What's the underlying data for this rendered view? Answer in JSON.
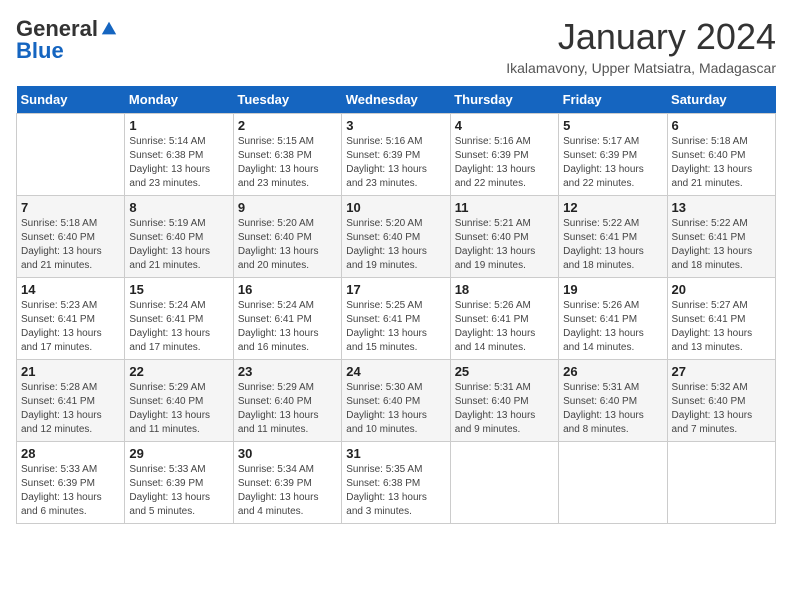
{
  "header": {
    "logo_general": "General",
    "logo_blue": "Blue",
    "month": "January 2024",
    "location": "Ikalamavony, Upper Matsiatra, Madagascar"
  },
  "weekdays": [
    "Sunday",
    "Monday",
    "Tuesday",
    "Wednesday",
    "Thursday",
    "Friday",
    "Saturday"
  ],
  "weeks": [
    [
      {
        "day": "",
        "info": ""
      },
      {
        "day": "1",
        "info": "Sunrise: 5:14 AM\nSunset: 6:38 PM\nDaylight: 13 hours\nand 23 minutes."
      },
      {
        "day": "2",
        "info": "Sunrise: 5:15 AM\nSunset: 6:38 PM\nDaylight: 13 hours\nand 23 minutes."
      },
      {
        "day": "3",
        "info": "Sunrise: 5:16 AM\nSunset: 6:39 PM\nDaylight: 13 hours\nand 23 minutes."
      },
      {
        "day": "4",
        "info": "Sunrise: 5:16 AM\nSunset: 6:39 PM\nDaylight: 13 hours\nand 22 minutes."
      },
      {
        "day": "5",
        "info": "Sunrise: 5:17 AM\nSunset: 6:39 PM\nDaylight: 13 hours\nand 22 minutes."
      },
      {
        "day": "6",
        "info": "Sunrise: 5:18 AM\nSunset: 6:40 PM\nDaylight: 13 hours\nand 21 minutes."
      }
    ],
    [
      {
        "day": "7",
        "info": "Sunrise: 5:18 AM\nSunset: 6:40 PM\nDaylight: 13 hours\nand 21 minutes."
      },
      {
        "day": "8",
        "info": "Sunrise: 5:19 AM\nSunset: 6:40 PM\nDaylight: 13 hours\nand 21 minutes."
      },
      {
        "day": "9",
        "info": "Sunrise: 5:20 AM\nSunset: 6:40 PM\nDaylight: 13 hours\nand 20 minutes."
      },
      {
        "day": "10",
        "info": "Sunrise: 5:20 AM\nSunset: 6:40 PM\nDaylight: 13 hours\nand 19 minutes."
      },
      {
        "day": "11",
        "info": "Sunrise: 5:21 AM\nSunset: 6:40 PM\nDaylight: 13 hours\nand 19 minutes."
      },
      {
        "day": "12",
        "info": "Sunrise: 5:22 AM\nSunset: 6:41 PM\nDaylight: 13 hours\nand 18 minutes."
      },
      {
        "day": "13",
        "info": "Sunrise: 5:22 AM\nSunset: 6:41 PM\nDaylight: 13 hours\nand 18 minutes."
      }
    ],
    [
      {
        "day": "14",
        "info": "Sunrise: 5:23 AM\nSunset: 6:41 PM\nDaylight: 13 hours\nand 17 minutes."
      },
      {
        "day": "15",
        "info": "Sunrise: 5:24 AM\nSunset: 6:41 PM\nDaylight: 13 hours\nand 17 minutes."
      },
      {
        "day": "16",
        "info": "Sunrise: 5:24 AM\nSunset: 6:41 PM\nDaylight: 13 hours\nand 16 minutes."
      },
      {
        "day": "17",
        "info": "Sunrise: 5:25 AM\nSunset: 6:41 PM\nDaylight: 13 hours\nand 15 minutes."
      },
      {
        "day": "18",
        "info": "Sunrise: 5:26 AM\nSunset: 6:41 PM\nDaylight: 13 hours\nand 14 minutes."
      },
      {
        "day": "19",
        "info": "Sunrise: 5:26 AM\nSunset: 6:41 PM\nDaylight: 13 hours\nand 14 minutes."
      },
      {
        "day": "20",
        "info": "Sunrise: 5:27 AM\nSunset: 6:41 PM\nDaylight: 13 hours\nand 13 minutes."
      }
    ],
    [
      {
        "day": "21",
        "info": "Sunrise: 5:28 AM\nSunset: 6:41 PM\nDaylight: 13 hours\nand 12 minutes."
      },
      {
        "day": "22",
        "info": "Sunrise: 5:29 AM\nSunset: 6:40 PM\nDaylight: 13 hours\nand 11 minutes."
      },
      {
        "day": "23",
        "info": "Sunrise: 5:29 AM\nSunset: 6:40 PM\nDaylight: 13 hours\nand 11 minutes."
      },
      {
        "day": "24",
        "info": "Sunrise: 5:30 AM\nSunset: 6:40 PM\nDaylight: 13 hours\nand 10 minutes."
      },
      {
        "day": "25",
        "info": "Sunrise: 5:31 AM\nSunset: 6:40 PM\nDaylight: 13 hours\nand 9 minutes."
      },
      {
        "day": "26",
        "info": "Sunrise: 5:31 AM\nSunset: 6:40 PM\nDaylight: 13 hours\nand 8 minutes."
      },
      {
        "day": "27",
        "info": "Sunrise: 5:32 AM\nSunset: 6:40 PM\nDaylight: 13 hours\nand 7 minutes."
      }
    ],
    [
      {
        "day": "28",
        "info": "Sunrise: 5:33 AM\nSunset: 6:39 PM\nDaylight: 13 hours\nand 6 minutes."
      },
      {
        "day": "29",
        "info": "Sunrise: 5:33 AM\nSunset: 6:39 PM\nDaylight: 13 hours\nand 5 minutes."
      },
      {
        "day": "30",
        "info": "Sunrise: 5:34 AM\nSunset: 6:39 PM\nDaylight: 13 hours\nand 4 minutes."
      },
      {
        "day": "31",
        "info": "Sunrise: 5:35 AM\nSunset: 6:38 PM\nDaylight: 13 hours\nand 3 minutes."
      },
      {
        "day": "",
        "info": ""
      },
      {
        "day": "",
        "info": ""
      },
      {
        "day": "",
        "info": ""
      }
    ]
  ]
}
